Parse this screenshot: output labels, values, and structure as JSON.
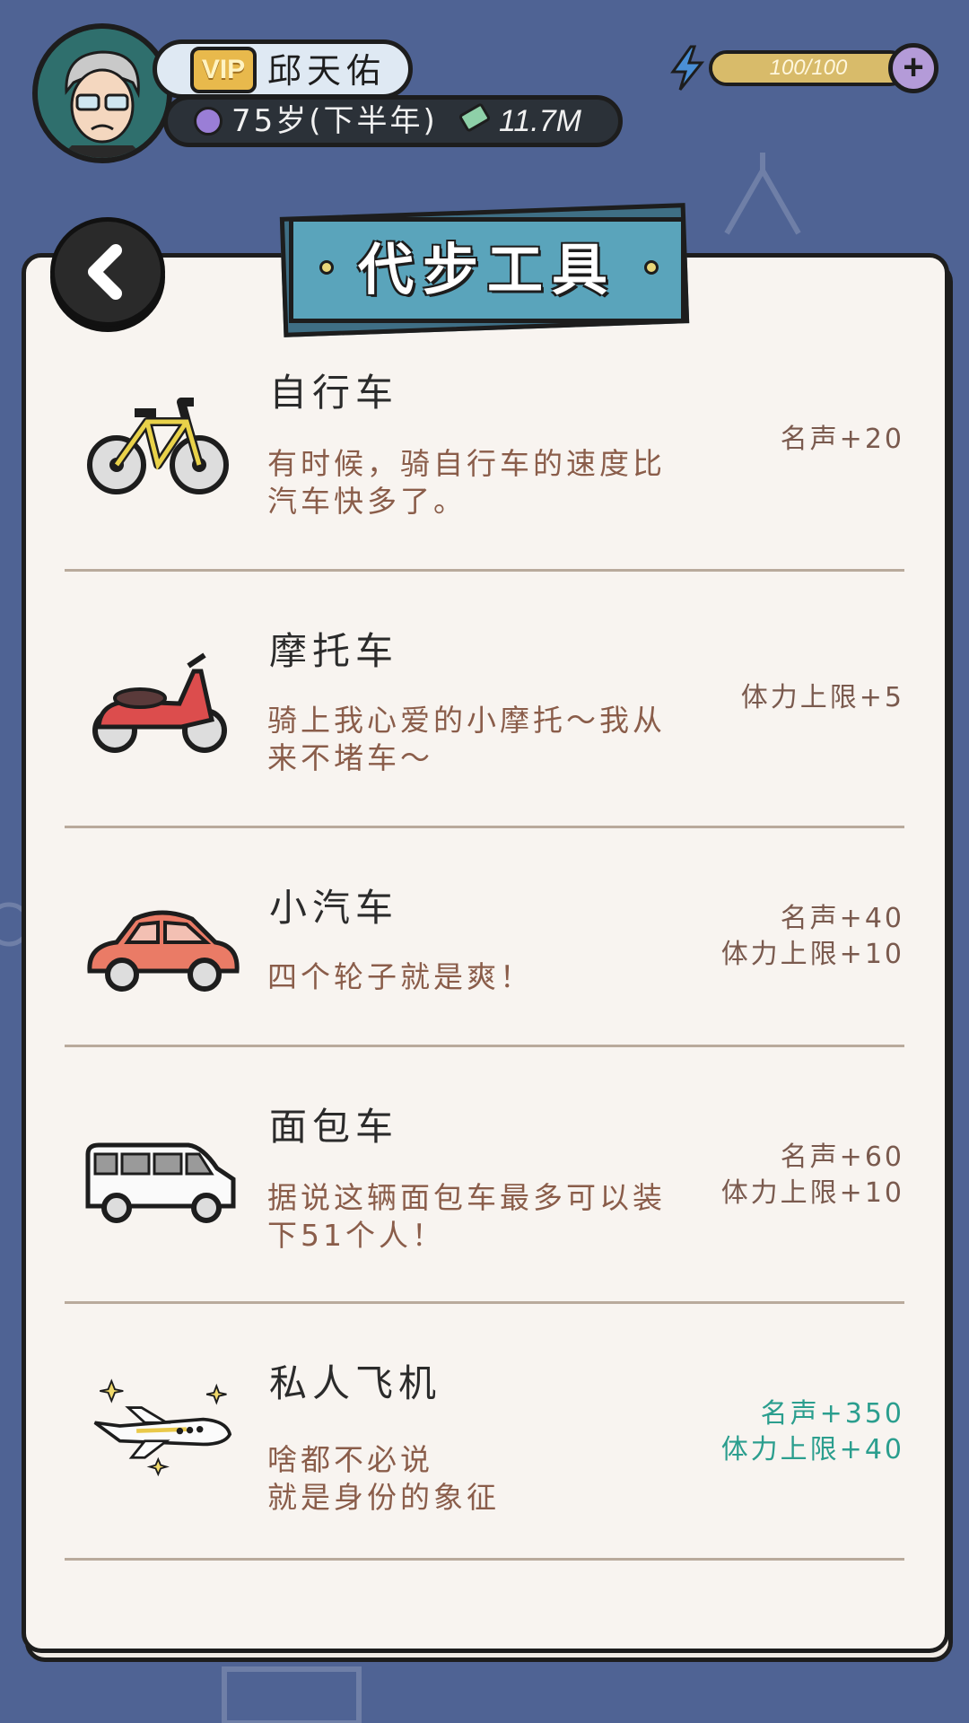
{
  "player": {
    "vip_label": "VIP",
    "name": "邱天佑",
    "age": "75岁(下半年)",
    "cash": "11.7M",
    "energy_text": "100/100",
    "energy_fraction": 1.0,
    "avatar": "old-man-avatar"
  },
  "header": {
    "title": "代步工具",
    "back_icon": "chevron-left-icon",
    "add_icon": "plus-icon",
    "energy_icon": "lightning-bolt-icon"
  },
  "items": [
    {
      "name": "自行车",
      "desc_lines": [
        "有时候，骑自行车的速度比",
        "汽车快多了。"
      ],
      "rewards": [
        "名声+20"
      ],
      "icon": "bicycle-icon",
      "highlight": false
    },
    {
      "name": "摩托车",
      "desc_lines": [
        "骑上我心爱的小摩托～我从",
        "来不堵车～"
      ],
      "rewards": [
        "体力上限+5"
      ],
      "icon": "scooter-icon",
      "highlight": false
    },
    {
      "name": "小汽车",
      "desc_lines": [
        "四个轮子就是爽！"
      ],
      "rewards": [
        "名声+40",
        "体力上限+10"
      ],
      "icon": "car-icon",
      "highlight": false
    },
    {
      "name": "面包车",
      "desc_lines": [
        "据说这辆面包车最多可以装",
        "下51个人！"
      ],
      "rewards": [
        "名声+60",
        "体力上限+10"
      ],
      "icon": "van-icon",
      "highlight": false
    },
    {
      "name": "私人飞机",
      "desc_lines": [
        "啥都不必说",
        "就是身份的象征"
      ],
      "rewards": [
        "名声+350",
        "体力上限+40"
      ],
      "icon": "private-jet-icon",
      "highlight": true
    }
  ],
  "colors": {
    "background": "#4f6394",
    "banner": "#5aa4bb",
    "reward_highlight": "#2b9e8e",
    "reward_normal": "#7a5a4e"
  }
}
